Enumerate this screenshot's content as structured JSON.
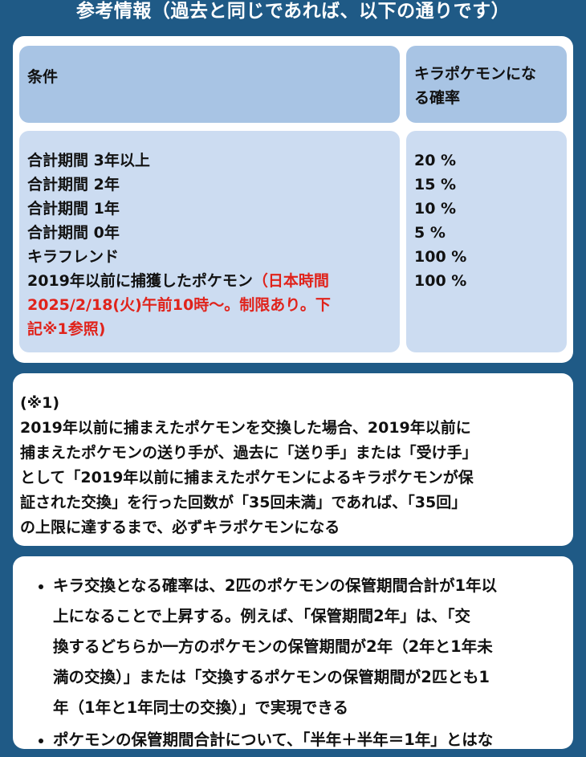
{
  "title": "参考情報（過去と同じであれば、以下の通りです）",
  "table": {
    "header_condition": "条件",
    "header_probability_lines": [
      "キラポケモンにな",
      "る確率"
    ],
    "conditions": [
      "合計期間 3年以上",
      "合計期間 2年",
      "合計期間 1年",
      "合計期間 0年",
      "キラフレンド"
    ],
    "last_condition": {
      "text": "2019年以前に捕獲したポケモン",
      "note_lines": [
        "（日本時間",
        "2025/2/18(火)午前10時〜。制限あり。下",
        "記※1参照)"
      ]
    },
    "probabilities": [
      "20 %",
      "15 %",
      "10 %",
      "5 %",
      "100 %",
      "100 %"
    ]
  },
  "note": {
    "label": "(※1)",
    "lines": [
      "2019年以前に捕まえたポケモンを交換した場合、2019年以前に",
      "捕まえたポケモンの送り手が、過去に「送り手」または「受け手」",
      "として「2019年以前に捕まえたポケモンによるキラポケモンが保",
      "証された交換」を行った回数が「35回未満」であれば、「35回」",
      "の上限に達するまで、必ずキラポケモンになる"
    ]
  },
  "bullets": [
    {
      "lines": [
        "キラ交換となる確率は、2匹のポケモンの保管期間合計が1年以",
        "上になることで上昇する。例えば、「保管期間2年」は、「交",
        "換するどちらか一方のポケモンの保管期間が2年（2年と1年未",
        "満の交換）」または「交換するポケモンの保管期間が2匹とも1",
        "年（1年と1年同士の交換）」で実現できる"
      ]
    },
    {
      "lines": [
        "ポケモンの保管期間合計について、「半年＋半年＝1年」とはな"
      ]
    }
  ]
}
